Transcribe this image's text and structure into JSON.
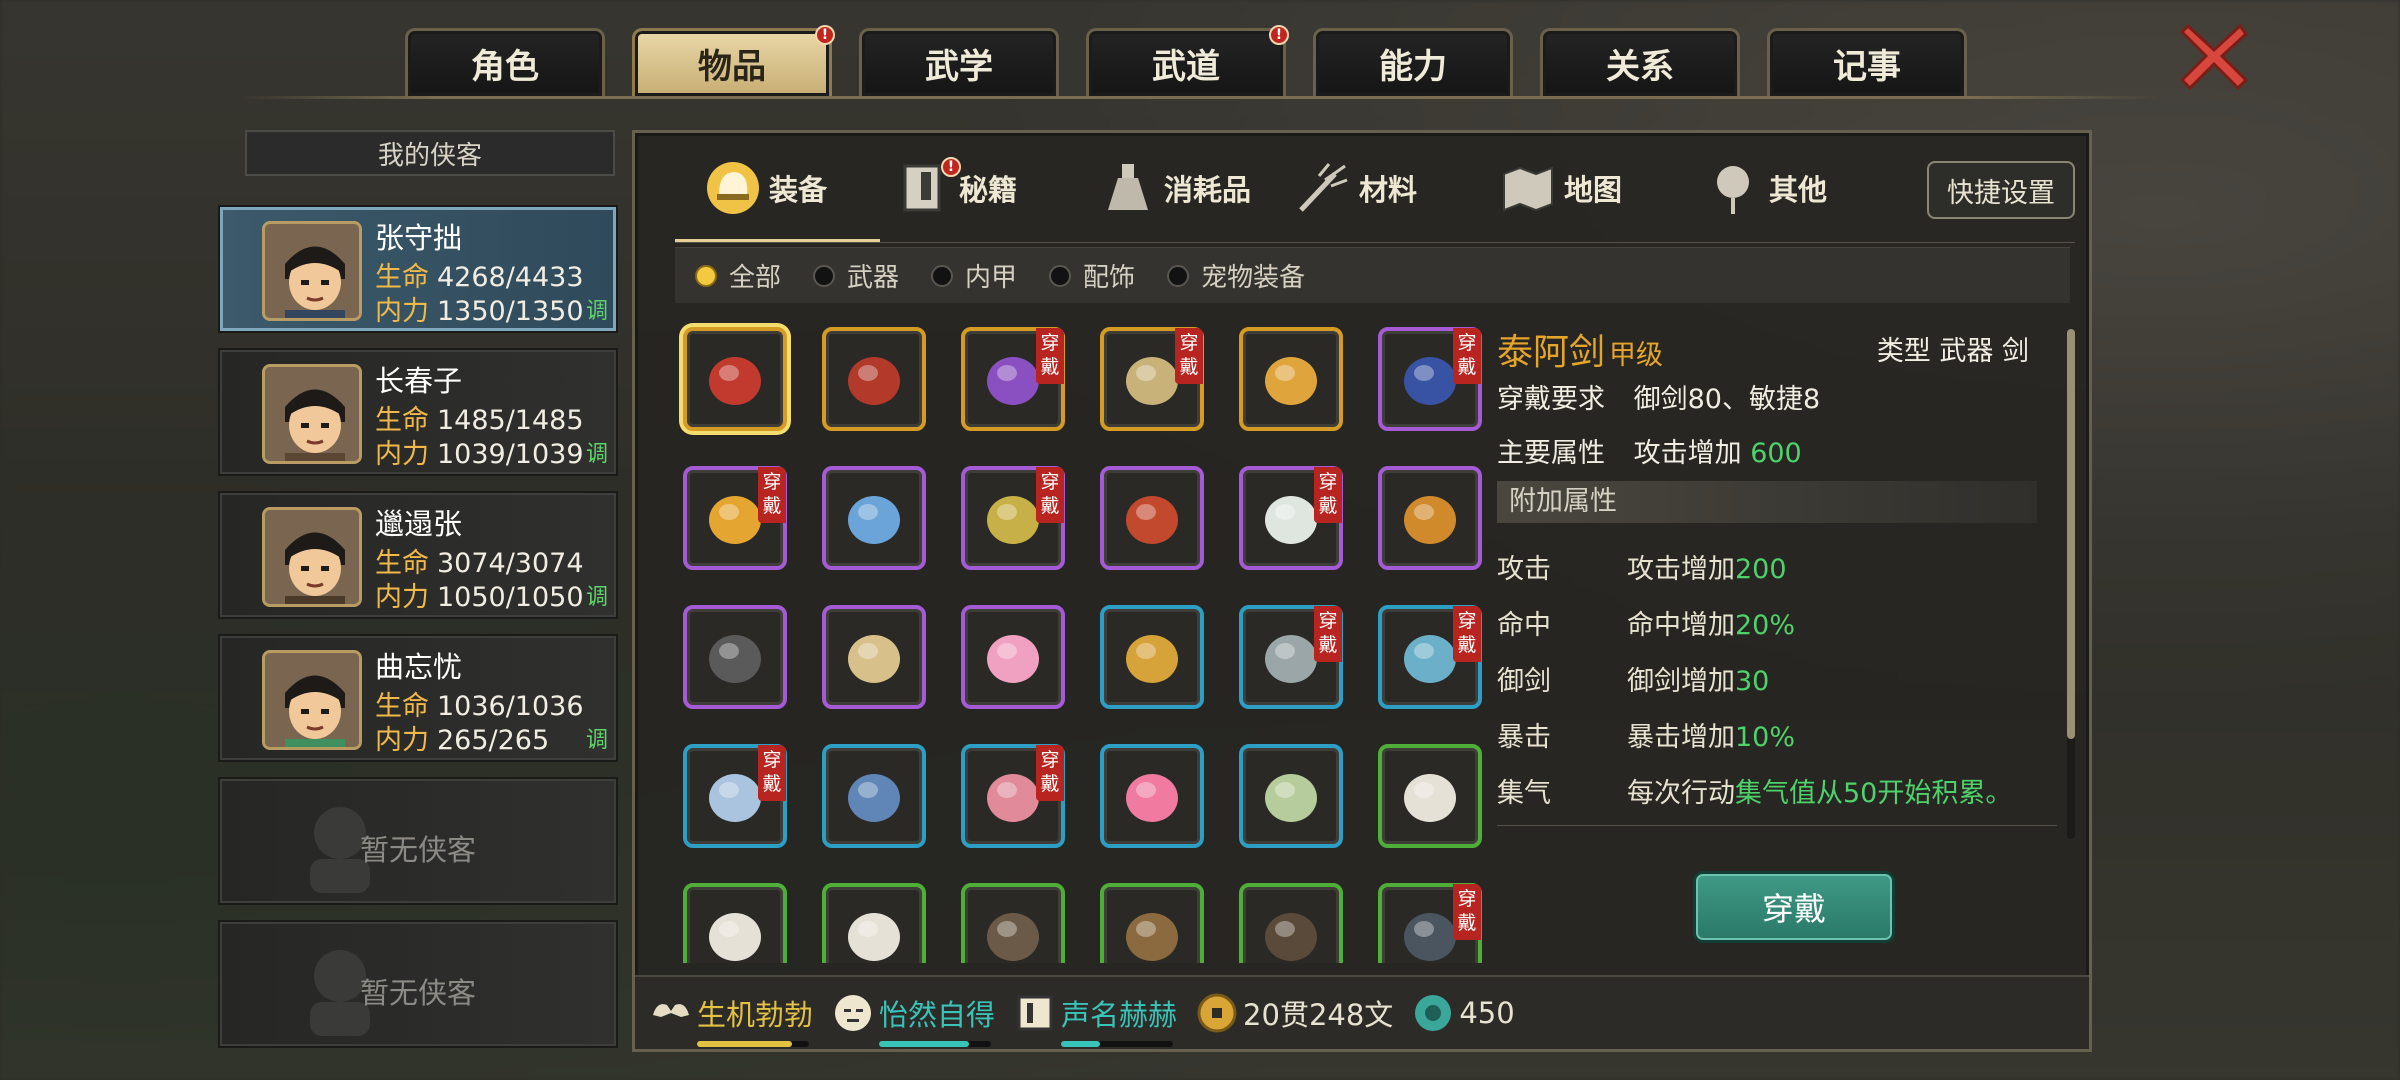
{
  "top_tabs": [
    {
      "label": "角色",
      "active": false,
      "badge": false
    },
    {
      "label": "物品",
      "active": true,
      "badge": true
    },
    {
      "label": "武学",
      "active": false,
      "badge": false
    },
    {
      "label": "武道",
      "active": false,
      "badge": true
    },
    {
      "label": "能力",
      "active": false,
      "badge": false
    },
    {
      "label": "关系",
      "active": false,
      "badge": false
    },
    {
      "label": "记事",
      "active": false,
      "badge": false
    }
  ],
  "badge_symbol": "!",
  "roster": {
    "header": "我的侠客",
    "hp_label": "生命",
    "mp_label": "内力",
    "tune_label": "调",
    "members": [
      {
        "name": "张守拙",
        "hp": "4268/4433",
        "mp": "1350/1350",
        "selected": true
      },
      {
        "name": "长春子",
        "hp": "1485/1485",
        "mp": "1039/1039",
        "selected": false
      },
      {
        "name": "邋遢张",
        "hp": "3074/3074",
        "mp": "1050/1050",
        "selected": false
      },
      {
        "name": "曲忘忧",
        "hp": "1036/1036",
        "mp": "265/265",
        "selected": false
      }
    ],
    "empty_label": "暂无侠客"
  },
  "categories": [
    {
      "label": "装备",
      "icon": "helmet-icon",
      "active": true,
      "badge": false
    },
    {
      "label": "秘籍",
      "icon": "book-icon",
      "active": false,
      "badge": true
    },
    {
      "label": "消耗品",
      "icon": "flask-icon",
      "active": false,
      "badge": false
    },
    {
      "label": "材料",
      "icon": "herb-icon",
      "active": false,
      "badge": false
    },
    {
      "label": "地图",
      "icon": "map-icon",
      "active": false,
      "badge": false
    },
    {
      "label": "其他",
      "icon": "lantern-icon",
      "active": false,
      "badge": false
    }
  ],
  "quick_settings_label": "快捷设置",
  "filters": [
    {
      "label": "全部",
      "on": true
    },
    {
      "label": "武器",
      "on": false
    },
    {
      "label": "内甲",
      "on": false
    },
    {
      "label": "配饰",
      "on": false
    },
    {
      "label": "宠物装备",
      "on": false
    }
  ],
  "wear_tag": "穿戴",
  "items": [
    {
      "name": "red-sword",
      "quality": "gold",
      "worn": false,
      "selected": true
    },
    {
      "name": "demon-mask",
      "quality": "gold",
      "worn": false
    },
    {
      "name": "purple-armor",
      "quality": "gold",
      "worn": true
    },
    {
      "name": "jade-token",
      "quality": "gold",
      "worn": true
    },
    {
      "name": "gold-mask",
      "quality": "gold",
      "worn": false
    },
    {
      "name": "blue-gauntlet",
      "quality": "purple",
      "worn": true
    },
    {
      "name": "golden-brush",
      "quality": "purple",
      "worn": true
    },
    {
      "name": "blue-boots",
      "quality": "purple",
      "worn": false
    },
    {
      "name": "gold-herb",
      "quality": "purple",
      "worn": true
    },
    {
      "name": "red-scroll",
      "quality": "purple",
      "worn": false
    },
    {
      "name": "white-orb",
      "quality": "purple",
      "worn": true
    },
    {
      "name": "gold-pendant",
      "quality": "purple",
      "worn": false
    },
    {
      "name": "iron-hat",
      "quality": "purple",
      "worn": false
    },
    {
      "name": "fang-necklace",
      "quality": "purple",
      "worn": false
    },
    {
      "name": "pink-charm",
      "quality": "purple",
      "worn": false
    },
    {
      "name": "gold-gloves",
      "quality": "blue",
      "worn": false
    },
    {
      "name": "steel-sword",
      "quality": "blue",
      "worn": true
    },
    {
      "name": "blue-sword",
      "quality": "blue",
      "worn": true
    },
    {
      "name": "white-robe",
      "quality": "blue",
      "worn": true
    },
    {
      "name": "blue-robe",
      "quality": "blue",
      "worn": false
    },
    {
      "name": "pink-dress",
      "quality": "blue",
      "worn": true
    },
    {
      "name": "peony-flower",
      "quality": "blue",
      "worn": false
    },
    {
      "name": "jade-ring",
      "quality": "blue",
      "worn": false
    },
    {
      "name": "cloth-wrap",
      "quality": "green",
      "worn": false
    },
    {
      "name": "cloth-wrap",
      "quality": "green",
      "worn": false
    },
    {
      "name": "cloth-wrap",
      "quality": "green",
      "worn": false
    },
    {
      "name": "trident",
      "quality": "green",
      "worn": false
    },
    {
      "name": "spear",
      "quality": "green",
      "worn": false
    },
    {
      "name": "brush-spear",
      "quality": "green",
      "worn": false
    },
    {
      "name": "curved-blade",
      "quality": "green",
      "worn": true
    }
  ],
  "detail": {
    "title": "泰阿剑",
    "grade": "甲级",
    "type_label": "类型",
    "type_value": "武器 剑",
    "req_label": "穿戴要求",
    "req_value": "御剑80、敏捷8",
    "main_label": "主要属性",
    "main_text": "攻击增加",
    "main_value": "600",
    "extra_header": "附加属性",
    "attrs": [
      {
        "k": "攻击",
        "text": "攻击增加",
        "value": "200"
      },
      {
        "k": "命中",
        "text": "命中增加",
        "value": "20%"
      },
      {
        "k": "御剑",
        "text": "御剑增加",
        "value": "30"
      },
      {
        "k": "暴击",
        "text": "暴击增加",
        "value": "10%"
      },
      {
        "k": "集气",
        "text": "每次行动",
        "value": "集气值从50开始积累。"
      }
    ],
    "equip_label": "穿戴"
  },
  "status": [
    {
      "label": "生机勃勃",
      "icon": "strength-icon",
      "color": "#e3c243",
      "fill": 0.85
    },
    {
      "label": "怡然自得",
      "icon": "face-icon",
      "color": "#38c4b8",
      "fill": 0.8
    },
    {
      "label": "声名赫赫",
      "icon": "fame-icon",
      "color": "#38c4b8",
      "fill": 0.35
    },
    {
      "label": "20贯248文",
      "icon": "coin-icon"
    },
    {
      "label": "450",
      "icon": "jade-icon"
    }
  ],
  "colors": {
    "gold": "#d49b25",
    "purple": "#a55ad6",
    "blue": "#2d9ec4",
    "green": "#4fae37",
    "accent_green": "#4ed26b",
    "title_orange": "#e5a42a"
  }
}
